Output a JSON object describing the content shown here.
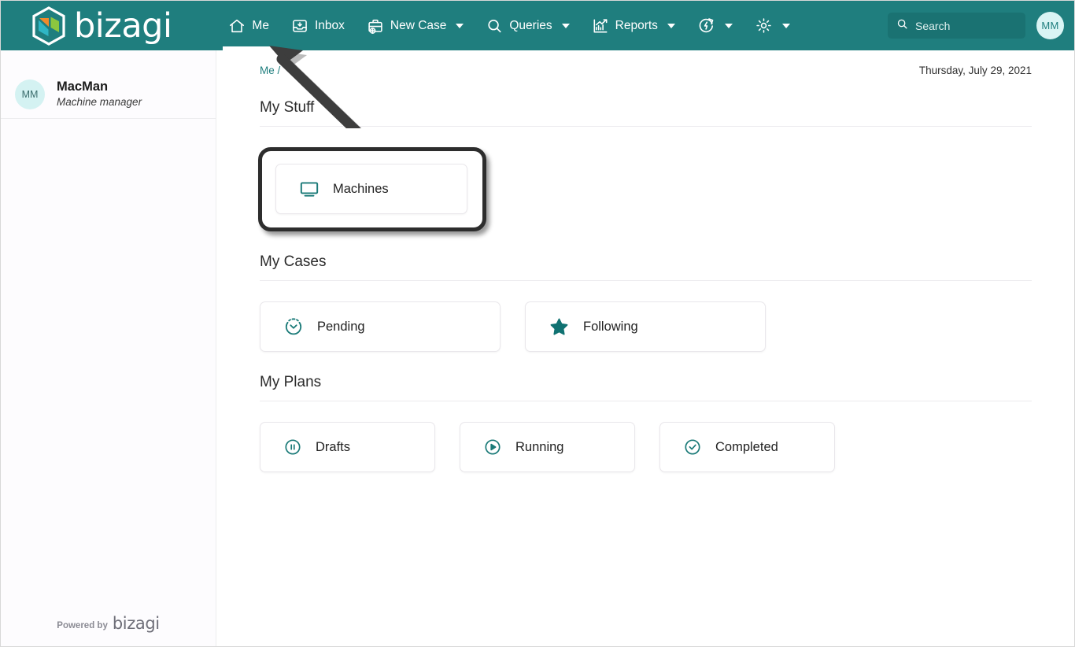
{
  "header": {
    "logo_word": "bizagi",
    "logo_icon": "bizagi-hexagon-logo",
    "nav": [
      {
        "id": "me",
        "label": "Me",
        "icon": "home-icon",
        "active": true,
        "caret": false
      },
      {
        "id": "inbox",
        "label": "Inbox",
        "icon": "inbox-icon",
        "active": false,
        "caret": false
      },
      {
        "id": "new-case",
        "label": "New Case",
        "icon": "briefcase-plus-icon",
        "active": false,
        "caret": true
      },
      {
        "id": "queries",
        "label": "Queries",
        "icon": "search-icon",
        "active": false,
        "caret": true
      },
      {
        "id": "reports",
        "label": "Reports",
        "icon": "chart-icon",
        "active": false,
        "caret": true
      },
      {
        "id": "automation",
        "label": "",
        "icon": "refresh-bolt-icon",
        "active": false,
        "caret": true
      },
      {
        "id": "settings",
        "label": "",
        "icon": "gear-icon",
        "active": false,
        "caret": true
      }
    ],
    "search": {
      "placeholder": "Search",
      "value": "",
      "icon": "search-icon"
    },
    "avatar": {
      "initials": "MM"
    }
  },
  "sidebar": {
    "user": {
      "initials": "MM",
      "name": "MacMan",
      "role": "Machine manager"
    },
    "footer": {
      "prefix": "Powered by",
      "brand": "bizagi"
    }
  },
  "main": {
    "breadcrumb": "Me /",
    "date": "Thursday, July 29, 2021",
    "sections": [
      {
        "id": "my-stuff",
        "title": "My Stuff",
        "cards": [
          {
            "id": "machines",
            "label": "Machines",
            "icon": "monitor-icon",
            "highlighted": true
          }
        ]
      },
      {
        "id": "my-cases",
        "title": "My Cases",
        "cards": [
          {
            "id": "pending",
            "label": "Pending",
            "icon": "clock-icon",
            "highlighted": false
          },
          {
            "id": "following",
            "label": "Following",
            "icon": "star-icon",
            "highlighted": false
          }
        ]
      },
      {
        "id": "my-plans",
        "title": "My Plans",
        "cards": [
          {
            "id": "drafts",
            "label": "Drafts",
            "icon": "pause-circle-icon",
            "highlighted": false
          },
          {
            "id": "running",
            "label": "Running",
            "icon": "play-circle-icon",
            "highlighted": false
          },
          {
            "id": "completed",
            "label": "Completed",
            "icon": "check-circle-icon",
            "highlighted": false
          }
        ]
      }
    ]
  },
  "annotations": {
    "arrow": {
      "name": "pointer-arrow",
      "target": "me-nav-tab",
      "color": "#3d3d3d"
    },
    "highlight_box": {
      "name": "highlight-box",
      "target": "machines-card",
      "color": "#2d2d2d"
    }
  },
  "colors": {
    "brand_teal": "#1f7e7e",
    "icon_teal": "#1a7a78",
    "sidebar_bg": "#fdfcfe",
    "card_border": "#e9e7eb",
    "annotation": "#2d2d2d"
  }
}
